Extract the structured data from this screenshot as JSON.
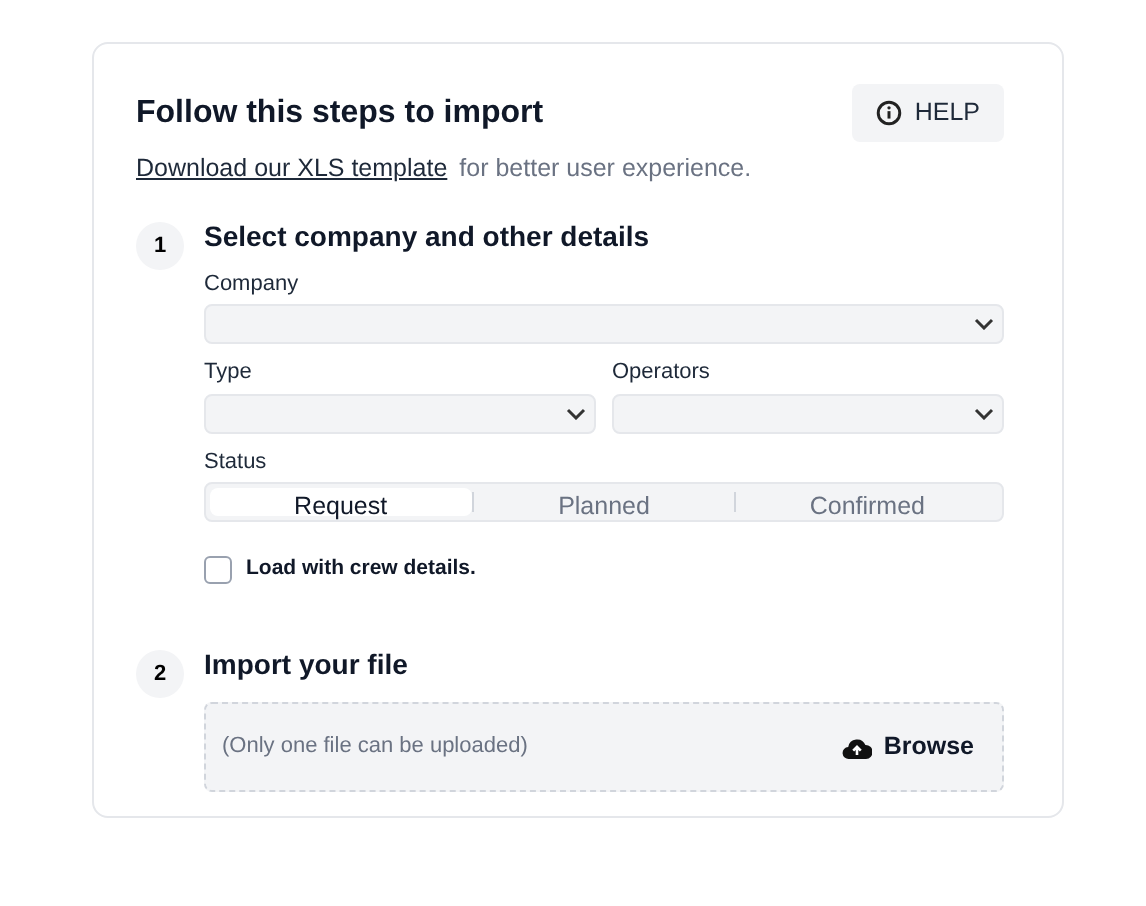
{
  "title": "Follow this steps to import",
  "help_button": {
    "label": "HELP"
  },
  "template": {
    "link": "Download our XLS template",
    "text": "for better user experience."
  },
  "steps": [
    {
      "number": "1",
      "title": "Select company and other details"
    },
    {
      "number": "2",
      "title": "Import your file"
    }
  ],
  "company": {
    "label": "Company"
  },
  "type": {
    "label": "Type"
  },
  "operators": {
    "label": "Operators"
  },
  "status": {
    "label": "Status",
    "options": [
      {
        "label": "Request",
        "selected": true
      },
      {
        "label": "Planned",
        "selected": false
      },
      {
        "label": "Confirmed",
        "selected": false
      }
    ]
  },
  "crew_checkbox": {
    "label": "Load with crew details.",
    "checked": false
  },
  "upload": {
    "hint": "(Only one file can be uploaded)",
    "button": "Browse"
  }
}
